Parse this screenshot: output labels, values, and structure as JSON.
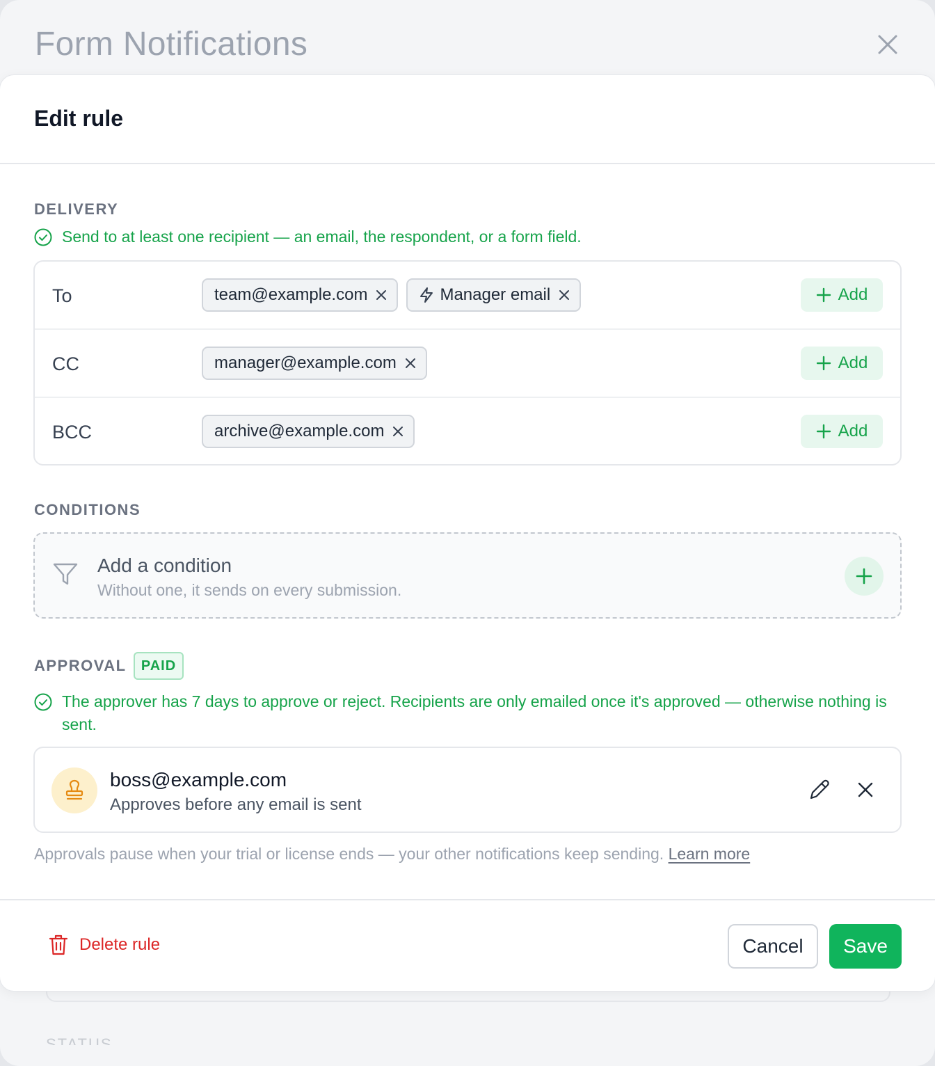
{
  "background": {
    "title": "Form Notifications",
    "status_label": "STATUS"
  },
  "modal": {
    "title": "Edit rule"
  },
  "delivery": {
    "label": "DELIVERY",
    "hint": "Send to at least one recipient — an email, the respondent, or a form field.",
    "add_label": "Add",
    "rows": [
      {
        "label": "To",
        "chips": [
          "team@example.com",
          "Manager email"
        ]
      },
      {
        "label": "CC",
        "chips": [
          "manager@example.com"
        ]
      },
      {
        "label": "BCC",
        "chips": [
          "archive@example.com"
        ]
      }
    ]
  },
  "conditions": {
    "label": "CONDITIONS",
    "title": "Add a condition",
    "subtitle": "Without one, it sends on every submission."
  },
  "approval": {
    "label": "APPROVAL",
    "badge": "PAID",
    "hint": "The approver has 7 days to approve or reject. Recipients are only emailed once it's approved — otherwise nothing is sent.",
    "approver_email": "boss@example.com",
    "approver_sub": "Approves before any email is sent",
    "footnote": "Approvals pause when your trial or license ends — your other notifications keep sending.",
    "learn_more": "Learn more"
  },
  "footer": {
    "delete_label": "Delete rule",
    "cancel_label": "Cancel",
    "save_label": "Save"
  },
  "colors": {
    "accent_green": "#16a34a",
    "save_green": "#10b45c",
    "danger_red": "#dc2626"
  }
}
